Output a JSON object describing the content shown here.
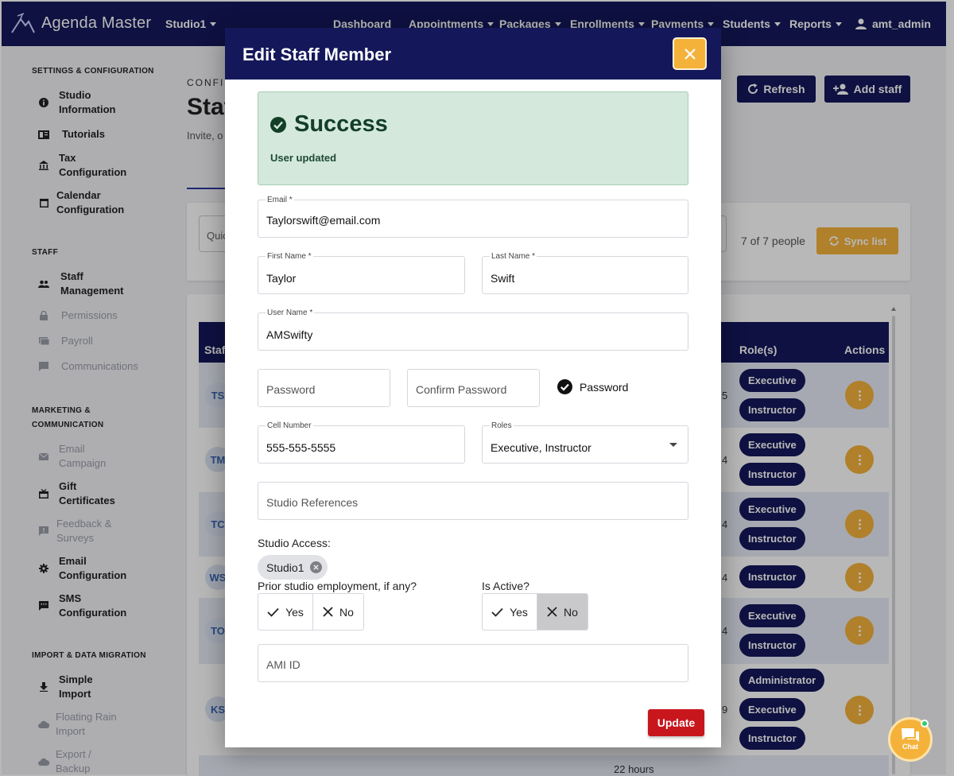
{
  "app": {
    "name": "Agenda Master",
    "studio": "Studio1"
  },
  "topnav": {
    "items": [
      "Dashboard",
      "Appointments",
      "Packages",
      "Enrollments",
      "Payments",
      "Students",
      "Reports"
    ],
    "user": "amt_admin"
  },
  "sidebar": {
    "sections": {
      "settings": "SETTINGS & CONFIGURATION",
      "staff": "STAFF",
      "marketing_1": "MARKETING &",
      "marketing_2": "COMMUNICATION",
      "import": "IMPORT & DATA MIGRATION"
    },
    "items": [
      {
        "label": "Studio\nInformation",
        "icon": "info-icon"
      },
      {
        "label": "Tutorials",
        "icon": "book-icon"
      },
      {
        "label": "Tax\nConfiguration",
        "icon": "bank-icon"
      },
      {
        "label": "Calendar\nConfiguration",
        "icon": "calendar-icon"
      },
      {
        "label": "Staff\nManagement",
        "icon": "people-icon"
      },
      {
        "label": "Permissions",
        "icon": "lock-icon"
      },
      {
        "label": "Payroll",
        "icon": "payroll-icon"
      },
      {
        "label": "Communications",
        "icon": "message-icon"
      },
      {
        "label": "Email\nCampaign",
        "icon": "mail-icon"
      },
      {
        "label": "Gift\nCertificates",
        "icon": "gift-icon"
      },
      {
        "label": "Feedback &\nSurveys",
        "icon": "feedback-icon"
      },
      {
        "label": "Email\nConfiguration",
        "icon": "gear-icon"
      },
      {
        "label": "SMS\nConfiguration",
        "icon": "sms-icon"
      },
      {
        "label": "Simple\nImport",
        "icon": "download-icon"
      },
      {
        "label": "Floating Rain\nImport",
        "icon": "cloud-icon"
      },
      {
        "label": "Export /\nBackup",
        "icon": "cloud-icon"
      }
    ]
  },
  "main": {
    "breadcrumb": "CONFI",
    "title": "Staf",
    "subtitle": "Invite, o",
    "refresh_label": "Refresh",
    "add_staff_label": "Add staff",
    "quick_placeholder": "Quic",
    "count_text": "7 of 7 people",
    "sync_label": "Sync list",
    "columns": {
      "staff": "Staf",
      "roles": "Role(s)",
      "actions": "Actions"
    },
    "rows": [
      {
        "initials": "TS",
        "hours": "5",
        "roles": [
          "Executive",
          "Instructor"
        ]
      },
      {
        "initials": "TM",
        "hours": "4",
        "roles": [
          "Executive",
          "Instructor"
        ]
      },
      {
        "initials": "TC",
        "hours": "4",
        "roles": [
          "Executive",
          "Instructor"
        ]
      },
      {
        "initials": "WS",
        "hours": "4",
        "roles": [
          "Instructor"
        ]
      },
      {
        "initials": "TO",
        "hours": "4",
        "roles": [
          "Executive",
          "Instructor"
        ]
      },
      {
        "initials": "KS",
        "hours": "9",
        "roles": [
          "Administrator",
          "Executive",
          "Instructor"
        ]
      }
    ],
    "bottom_hours": "22 hours"
  },
  "modal": {
    "title": "Edit Staff Member",
    "alert": {
      "title": "Success",
      "message": "User updated"
    },
    "email": {
      "label": "Email *",
      "value": "Taylorswift@email.com"
    },
    "first_name": {
      "label": "First Name *",
      "value": "Taylor"
    },
    "last_name": {
      "label": "Last Name *",
      "value": "Swift"
    },
    "username": {
      "label": "User Name *",
      "value": "AMSwifty"
    },
    "password_placeholder": "Password",
    "confirm_password_placeholder": "Confirm Password",
    "show_password_label": "Password",
    "cell": {
      "label": "Cell Number",
      "value": "555-555-5555"
    },
    "roles": {
      "label": "Roles",
      "value": "Executive, Instructor"
    },
    "studio_refs_placeholder": "Studio References",
    "studio_access_label": "Studio Access:",
    "studio_access_chip": "Studio1",
    "prior_employment_label": "Prior studio employment, if any?",
    "is_active_label": "Is Active?",
    "yes_label": "Yes",
    "no_label": "No",
    "ami_id_placeholder": "AMI ID",
    "update_label": "Update"
  },
  "chat_label": "Chat",
  "colors": {
    "navy": "#14185a",
    "accent": "#f4b23b",
    "success_bg": "#d4e8dc",
    "danger": "#c8161d"
  }
}
